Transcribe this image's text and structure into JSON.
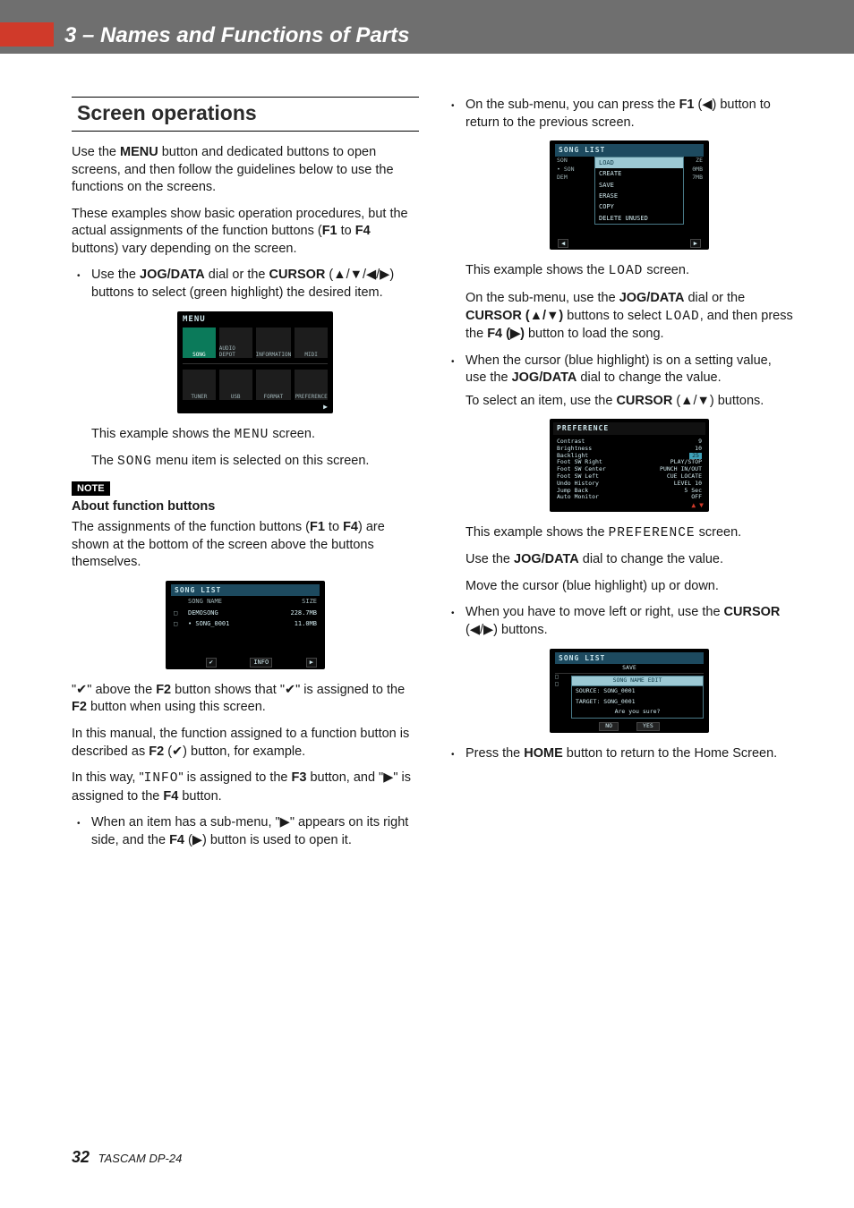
{
  "header": {
    "chapter": "3 – Names and Functions of Parts"
  },
  "section_title": "Screen operations",
  "intro1": "Use the MENU button and dedicated buttons to open screens, and then follow the guidelines below to use the functions on the screens.",
  "intro2": "These examples show basic operation procedures, but the actual assignments of the function buttons (F1 to F4 buttons) vary depending on the screen.",
  "b1_pre": "Use the ",
  "b1_jog": "JOG/DATA",
  "b1_mid": " dial or the ",
  "b1_cur": "CURSOR",
  "b1_post": " (▲/▼/◀/▶) buttons to select (green highlight) the desired item.",
  "menu_fig": {
    "title": "MENU",
    "cells": [
      "SONG",
      "AUDIO DEPOT",
      "INFORMATION",
      "MIDI",
      "TUNER",
      "USB",
      "FORMAT",
      "PREFERENCE"
    ]
  },
  "menu_caption1a": "This example shows the ",
  "menu_caption1b": "MENU",
  "menu_caption1c": " screen.",
  "menu_caption2a": "The ",
  "menu_caption2b": "SONG",
  "menu_caption2c": " menu item is selected on this screen.",
  "note_badge": "NOTE",
  "note_sub": "About function buttons",
  "note_p": "The assignments of the function buttons (F1 to F4) are shown at the bottom of the screen above the buttons themselves.",
  "sl_fig": {
    "title": "SONG LIST",
    "head": {
      "c2": "SONG NAME",
      "c3": "SIZE"
    },
    "rows": [
      {
        "c1": "□",
        "c2": "DEMOSONG",
        "c3": "228.7MB"
      },
      {
        "c1": "□",
        "c2": "• SONG_0001",
        "c3": "11.0MB"
      }
    ],
    "f2": "✔",
    "f3": "INFO",
    "f4": "▶"
  },
  "sl_p1": "\"✔\" above the F2 button shows that \"✔\" is assigned to the F2 button when using this screen.",
  "sl_p2": "In this manual, the function assigned to a function button is described as F2 (✔) button, for example.",
  "sl_p3a": "In this way, \"",
  "sl_p3b": "INFO",
  "sl_p3c": "\" is assigned to the F3 button, and \"▶\" is assigned to the F4 button.",
  "b2": "When an item has a sub-menu, \"▶\" appears on its right side, and the F4 (▶) button is used to open it.",
  "b3": "On the sub-menu, you can press the F1 (◀) button to return to the previous screen.",
  "sub_fig": {
    "title": "SONG LIST",
    "left": [
      "SON",
      "• SON",
      "DEM"
    ],
    "items": [
      "LOAD",
      "CREATE",
      "SAVE",
      "ERASE",
      "COPY",
      "DELETE UNUSED"
    ],
    "right": [
      "ZE",
      "0MB",
      "7MB"
    ]
  },
  "sub_p1a": "This example shows the ",
  "sub_p1b": "LOAD",
  "sub_p1c": " screen.",
  "sub_p2a": "On the sub-menu, use the ",
  "sub_p2b": "JOG/DATA",
  "sub_p2c": " dial or the ",
  "sub_p2d": "CURSOR (▲/▼)",
  "sub_p2e": " buttons to select ",
  "sub_p2f": "LOAD",
  "sub_p2g": ", and then press the ",
  "sub_p2h": "F4 (▶)",
  "sub_p2i": " button to load the song.",
  "b4a": "When the cursor (blue highlight) is on a setting value, use the ",
  "b4b": "JOG/DATA",
  "b4c": " dial to change the value.",
  "b4d": "To select an item, use the ",
  "b4e": "CURSOR",
  "b4f": " (▲/▼) buttons.",
  "pref_fig": {
    "title": "PREFERENCE",
    "rows": [
      {
        "k": "Contrast",
        "v": "9"
      },
      {
        "k": "Brightness",
        "v": "10"
      },
      {
        "k": "Backlight",
        "v": "25",
        "sel": true
      },
      {
        "k": "Foot SW Right",
        "v": "PLAY/STOP"
      },
      {
        "k": "Foot SW Center",
        "v": "PUNCH IN/OUT"
      },
      {
        "k": "Foot SW Left",
        "v": "CUE LOCATE"
      },
      {
        "k": "Undo History",
        "v": "LEVEL 10"
      },
      {
        "k": "Jump Back",
        "v": "5 Sec"
      },
      {
        "k": "Auto Monitor",
        "v": "OFF"
      }
    ]
  },
  "pref_p1a": "This example shows the ",
  "pref_p1b": "PREFERENCE",
  "pref_p1c": " screen.",
  "pref_p2a": "Use the ",
  "pref_p2b": "JOG/DATA",
  "pref_p2c": " dial to change the value.",
  "pref_p3": "Move the cursor (blue highlight) up or down.",
  "b5a": "When you have to move left or right, use the ",
  "b5b": "CURSOR",
  "b5c": " (◀/▶) buttons.",
  "save_fig": {
    "title": "SONG LIST",
    "save_label": "SAVE",
    "edit": "SONG NAME EDIT",
    "src": "SOURCE: SONG_0001",
    "tgt": "TARGET: SONG_0001",
    "q": "Are you sure?",
    "no": "NO",
    "yes": "YES"
  },
  "b6a": "Press the ",
  "b6b": "HOME",
  "b6c": " button to return to the Home Screen.",
  "footer": {
    "page": "32",
    "model": "TASCAM DP-24"
  }
}
